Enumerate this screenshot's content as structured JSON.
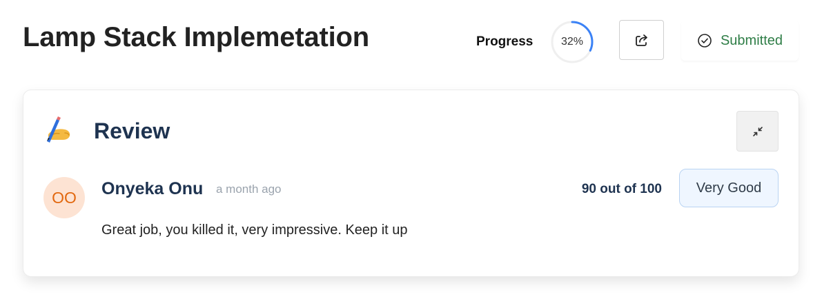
{
  "header": {
    "title": "Lamp Stack Implemetation",
    "progress_label": "Progress",
    "progress_value": "32%",
    "progress_fraction": 0.32,
    "share_icon": "share-icon",
    "status_icon": "check-circle-icon",
    "status_label": "Submitted"
  },
  "review": {
    "title": "Review",
    "emoji": "writing-hand-icon",
    "collapse_icon": "collapse-icon",
    "reviewer": {
      "initials": "OO",
      "name": "Onyeka Onu",
      "timestamp": "a month ago"
    },
    "score": "90 out of 100",
    "rating": "Very Good",
    "comment": "Great job, you killed it, very impressive. Keep it up"
  },
  "colors": {
    "accent": "#3b82f6",
    "success": "#2e7d46",
    "avatar_bg": "#fde3d3",
    "avatar_text": "#e2680f",
    "heading": "#1e3350"
  }
}
